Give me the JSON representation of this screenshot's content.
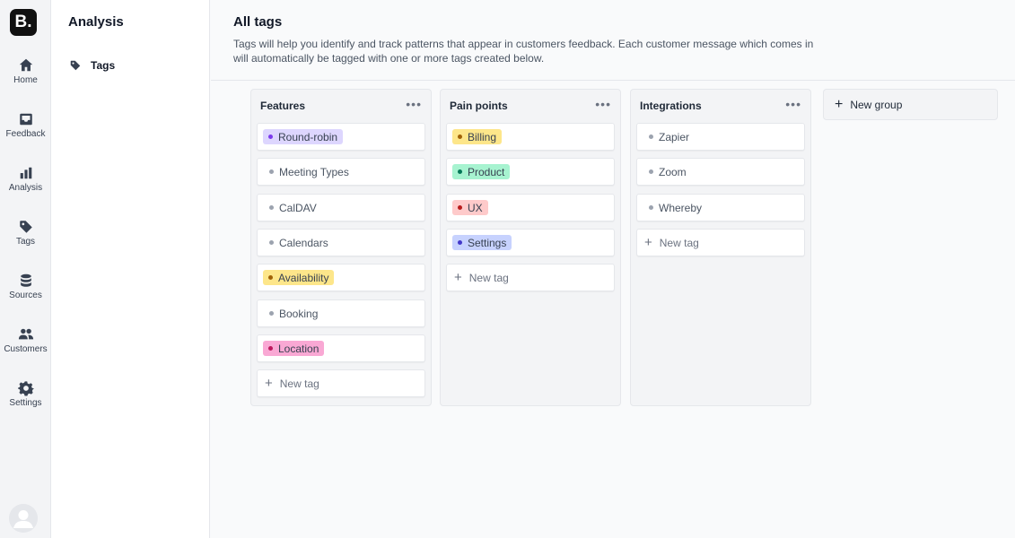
{
  "app": {
    "logo_text": "B."
  },
  "rail": {
    "items": [
      {
        "label": "Home",
        "icon": "home-icon"
      },
      {
        "label": "Feedback",
        "icon": "inbox-icon"
      },
      {
        "label": "Analysis",
        "icon": "bar-chart-icon"
      },
      {
        "label": "Tags",
        "icon": "tag-icon"
      },
      {
        "label": "Sources",
        "icon": "database-icon"
      },
      {
        "label": "Customers",
        "icon": "users-icon"
      },
      {
        "label": "Settings",
        "icon": "gear-icon"
      }
    ]
  },
  "sidebar": {
    "title": "Analysis",
    "items": [
      {
        "label": "Tags",
        "icon": "tag-icon"
      }
    ]
  },
  "header": {
    "title": "All tags",
    "description": "Tags will help you identify and track patterns that appear in customers feedback. Each customer message which comes in will automatically be tagged with one or more tags created below."
  },
  "groups": [
    {
      "title": "Features",
      "menu": "•••",
      "tags": [
        {
          "label": "Round-robin",
          "color": "#ddd6fe",
          "dot": "#7c3aed"
        },
        {
          "label": "Meeting Types",
          "color": null
        },
        {
          "label": "CalDAV",
          "color": null
        },
        {
          "label": "Calendars",
          "color": null
        },
        {
          "label": "Availability",
          "color": "#fde68a",
          "dot": "#a16207"
        },
        {
          "label": "Booking",
          "color": null
        },
        {
          "label": "Location",
          "color": "#f9a8d4",
          "dot": "#be185d"
        }
      ],
      "new_tag": "New tag"
    },
    {
      "title": "Pain points",
      "menu": "•••",
      "tags": [
        {
          "label": "Billing",
          "color": "#fde68a",
          "dot": "#a16207"
        },
        {
          "label": "Product",
          "color": "#a7f3d0",
          "dot": "#047857"
        },
        {
          "label": "UX",
          "color": "#fecaca",
          "dot": "#b91c1c"
        },
        {
          "label": "Settings",
          "color": "#c7d2fe",
          "dot": "#4338ca"
        }
      ],
      "new_tag": "New tag"
    },
    {
      "title": "Integrations",
      "menu": "•••",
      "tags": [
        {
          "label": "Zapier",
          "color": null
        },
        {
          "label": "Zoom",
          "color": null
        },
        {
          "label": "Whereby",
          "color": null
        }
      ],
      "new_tag": "New tag"
    }
  ],
  "new_group": {
    "label": "New group"
  }
}
